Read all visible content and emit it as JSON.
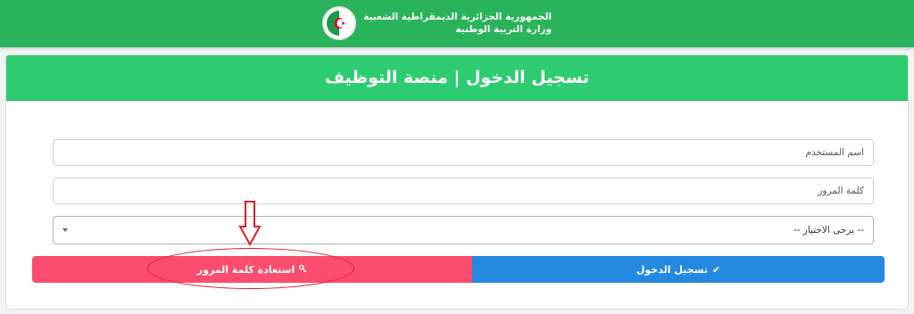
{
  "header": {
    "line1": "الجمهورية الجزائرية الديمقراطية الشعبية",
    "line2": "وزارة التربية الوطنية"
  },
  "card": {
    "title": "تسجيل الدخول | منصة التوظيف"
  },
  "form": {
    "username_placeholder": "اسم المستخدم",
    "password_placeholder": "كلمة المرور",
    "select_value": "-- يرجى الاختيار --"
  },
  "buttons": {
    "login_label": "تسجيل الدخول",
    "login_icon": "check-icon",
    "recover_label": "استعادة كلمة المرور",
    "recover_icon": "key-icon"
  },
  "colors": {
    "topbar": "#2ab35a",
    "card_header": "#2ecc71",
    "login_button": "#2489e0",
    "recover_button": "#fc4d6e",
    "annotation": "#d8202a"
  }
}
